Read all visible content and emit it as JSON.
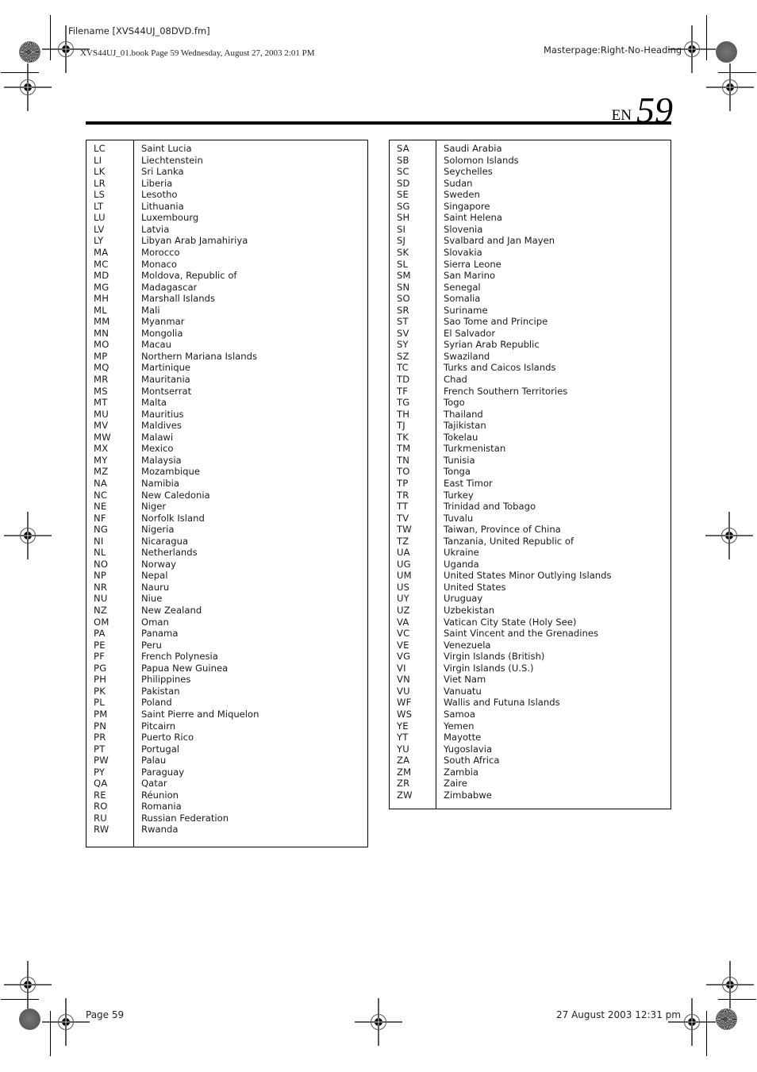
{
  "header": {
    "filename": "Filename [XVS44UJ_08DVD.fm]",
    "book_info": "XVS44UJ_01.book  Page 59  Wednesday, August 27, 2003  2:01 PM",
    "masterpage": "Masterpage:Right-No-Heading"
  },
  "page_title": {
    "lang": "EN",
    "page_number": "59"
  },
  "left_table": [
    {
      "code": "LC",
      "name": "Saint Lucia"
    },
    {
      "code": "LI",
      "name": "Liechtenstein"
    },
    {
      "code": "LK",
      "name": "Sri Lanka"
    },
    {
      "code": "LR",
      "name": "Liberia"
    },
    {
      "code": "LS",
      "name": "Lesotho"
    },
    {
      "code": "LT",
      "name": "Lithuania"
    },
    {
      "code": "LU",
      "name": "Luxembourg"
    },
    {
      "code": "LV",
      "name": "Latvia"
    },
    {
      "code": "LY",
      "name": "Libyan Arab Jamahiriya"
    },
    {
      "code": "MA",
      "name": "Morocco"
    },
    {
      "code": "MC",
      "name": "Monaco"
    },
    {
      "code": "MD",
      "name": "Moldova, Republic of"
    },
    {
      "code": "MG",
      "name": "Madagascar"
    },
    {
      "code": "MH",
      "name": "Marshall Islands"
    },
    {
      "code": "ML",
      "name": "Mali"
    },
    {
      "code": "MM",
      "name": "Myanmar"
    },
    {
      "code": "MN",
      "name": "Mongolia"
    },
    {
      "code": "MO",
      "name": "Macau"
    },
    {
      "code": "MP",
      "name": "Northern Mariana Islands"
    },
    {
      "code": "MQ",
      "name": "Martinique"
    },
    {
      "code": "MR",
      "name": "Mauritania"
    },
    {
      "code": "MS",
      "name": "Montserrat"
    },
    {
      "code": "MT",
      "name": "Malta"
    },
    {
      "code": "MU",
      "name": "Mauritius"
    },
    {
      "code": "MV",
      "name": "Maldives"
    },
    {
      "code": "MW",
      "name": "Malawi"
    },
    {
      "code": "MX",
      "name": "Mexico"
    },
    {
      "code": "MY",
      "name": "Malaysia"
    },
    {
      "code": "MZ",
      "name": "Mozambique"
    },
    {
      "code": "NA",
      "name": "Namibia"
    },
    {
      "code": "NC",
      "name": "New Caledonia"
    },
    {
      "code": "NE",
      "name": "Niger"
    },
    {
      "code": "NF",
      "name": "Norfolk Island"
    },
    {
      "code": "NG",
      "name": "Nigeria"
    },
    {
      "code": "NI",
      "name": "Nicaragua"
    },
    {
      "code": "NL",
      "name": "Netherlands"
    },
    {
      "code": "NO",
      "name": "Norway"
    },
    {
      "code": "NP",
      "name": "Nepal"
    },
    {
      "code": "NR",
      "name": "Nauru"
    },
    {
      "code": "NU",
      "name": "Niue"
    },
    {
      "code": "NZ",
      "name": "New Zealand"
    },
    {
      "code": "OM",
      "name": "Oman"
    },
    {
      "code": "PA",
      "name": "Panama"
    },
    {
      "code": "PE",
      "name": "Peru"
    },
    {
      "code": "PF",
      "name": "French Polynesia"
    },
    {
      "code": "PG",
      "name": "Papua New Guinea"
    },
    {
      "code": "PH",
      "name": "Philippines"
    },
    {
      "code": "PK",
      "name": "Pakistan"
    },
    {
      "code": "PL",
      "name": "Poland"
    },
    {
      "code": "PM",
      "name": "Saint Pierre and Miquelon"
    },
    {
      "code": "PN",
      "name": "Pitcairn"
    },
    {
      "code": "PR",
      "name": "Puerto Rico"
    },
    {
      "code": "PT",
      "name": "Portugal"
    },
    {
      "code": "PW",
      "name": "Palau"
    },
    {
      "code": "PY",
      "name": "Paraguay"
    },
    {
      "code": "QA",
      "name": "Qatar"
    },
    {
      "code": "RE",
      "name": "Réunion"
    },
    {
      "code": "RO",
      "name": "Romania"
    },
    {
      "code": "RU",
      "name": "Russian Federation"
    },
    {
      "code": "RW",
      "name": "Rwanda"
    }
  ],
  "right_table": [
    {
      "code": "SA",
      "name": "Saudi Arabia"
    },
    {
      "code": "SB",
      "name": "Solomon Islands"
    },
    {
      "code": "SC",
      "name": "Seychelles"
    },
    {
      "code": "SD",
      "name": "Sudan"
    },
    {
      "code": "SE",
      "name": "Sweden"
    },
    {
      "code": "SG",
      "name": "Singapore"
    },
    {
      "code": "SH",
      "name": "Saint Helena"
    },
    {
      "code": "SI",
      "name": "Slovenia"
    },
    {
      "code": "SJ",
      "name": "Svalbard and Jan Mayen"
    },
    {
      "code": "SK",
      "name": "Slovakia"
    },
    {
      "code": "SL",
      "name": "Sierra Leone"
    },
    {
      "code": "SM",
      "name": "San Marino"
    },
    {
      "code": "SN",
      "name": "Senegal"
    },
    {
      "code": "SO",
      "name": "Somalia"
    },
    {
      "code": "SR",
      "name": "Suriname"
    },
    {
      "code": "ST",
      "name": "Sao Tome and Principe"
    },
    {
      "code": "SV",
      "name": "El Salvador"
    },
    {
      "code": "SY",
      "name": "Syrian Arab Republic"
    },
    {
      "code": "SZ",
      "name": "Swaziland"
    },
    {
      "code": "TC",
      "name": "Turks and Caicos Islands"
    },
    {
      "code": "TD",
      "name": "Chad"
    },
    {
      "code": "TF",
      "name": "French Southern Territories"
    },
    {
      "code": "TG",
      "name": "Togo"
    },
    {
      "code": "TH",
      "name": "Thailand"
    },
    {
      "code": "TJ",
      "name": "Tajikistan"
    },
    {
      "code": "TK",
      "name": "Tokelau"
    },
    {
      "code": "TM",
      "name": "Turkmenistan"
    },
    {
      "code": "TN",
      "name": "Tunisia"
    },
    {
      "code": "TO",
      "name": "Tonga"
    },
    {
      "code": "TP",
      "name": "East Timor"
    },
    {
      "code": "TR",
      "name": "Turkey"
    },
    {
      "code": "TT",
      "name": "Trinidad and Tobago"
    },
    {
      "code": "TV",
      "name": "Tuvalu"
    },
    {
      "code": "TW",
      "name": "Taiwan, Province of China"
    },
    {
      "code": "TZ",
      "name": "Tanzania, United Republic of"
    },
    {
      "code": "UA",
      "name": "Ukraine"
    },
    {
      "code": "UG",
      "name": "Uganda"
    },
    {
      "code": "UM",
      "name": "United States Minor Outlying Islands"
    },
    {
      "code": "US",
      "name": "United States"
    },
    {
      "code": "UY",
      "name": "Uruguay"
    },
    {
      "code": "UZ",
      "name": "Uzbekistan"
    },
    {
      "code": "VA",
      "name": "Vatican City State (Holy See)"
    },
    {
      "code": "VC",
      "name": "Saint Vincent and the Grenadines"
    },
    {
      "code": "VE",
      "name": "Venezuela"
    },
    {
      "code": "VG",
      "name": "Virgin Islands (British)"
    },
    {
      "code": "VI",
      "name": "Virgin Islands (U.S.)"
    },
    {
      "code": "VN",
      "name": "Viet Nam"
    },
    {
      "code": "VU",
      "name": "Vanuatu"
    },
    {
      "code": "WF",
      "name": "Wallis and Futuna Islands"
    },
    {
      "code": "WS",
      "name": "Samoa"
    },
    {
      "code": "YE",
      "name": "Yemen"
    },
    {
      "code": "YT",
      "name": "Mayotte"
    },
    {
      "code": "YU",
      "name": "Yugoslavia"
    },
    {
      "code": "ZA",
      "name": "South Africa"
    },
    {
      "code": "ZM",
      "name": "Zambia"
    },
    {
      "code": "ZR",
      "name": "Zaire"
    },
    {
      "code": "ZW",
      "name": "Zimbabwe"
    }
  ],
  "footer": {
    "page_label": "Page 59",
    "datetime": "27 August 2003 12:31 pm"
  }
}
